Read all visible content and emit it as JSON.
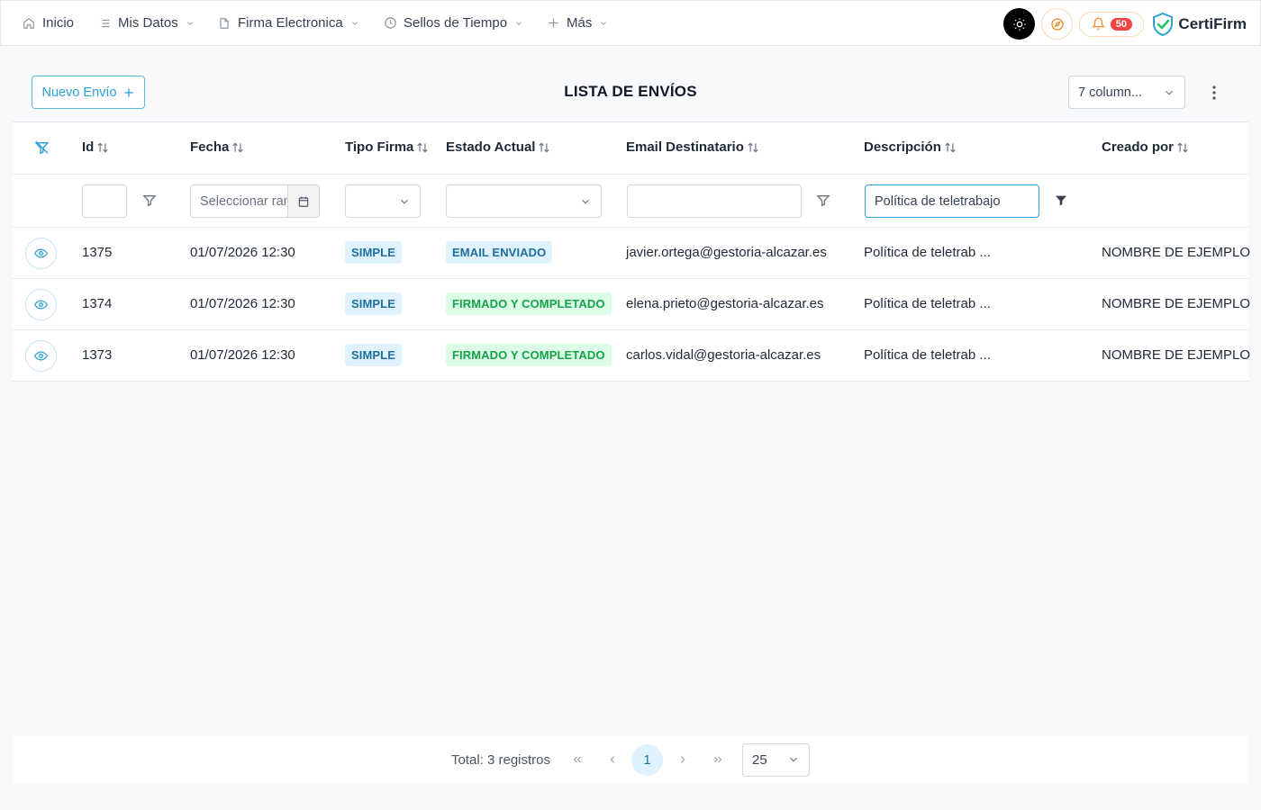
{
  "nav": {
    "items": [
      {
        "label": "Inicio",
        "icon": "home-icon"
      },
      {
        "label": "Mis Datos",
        "icon": "list-icon"
      },
      {
        "label": "Firma Electronica",
        "icon": "document-icon"
      },
      {
        "label": "Sellos de Tiempo",
        "icon": "clock-icon"
      },
      {
        "label": "Más",
        "icon": "plus-icon"
      }
    ],
    "notifications_count": "50",
    "brand": "CertiFirm"
  },
  "page": {
    "title": "LISTA DE ENVÍOS",
    "new_button": "Nuevo Envío",
    "columns_select": "7 column..."
  },
  "table": {
    "headers": [
      "Id",
      "Fecha",
      "Tipo Firma",
      "Estado Actual",
      "Email Destinatario",
      "Descripción",
      "Creado por"
    ],
    "filters": {
      "id": "",
      "fecha_placeholder": "Seleccionar rango",
      "tipo": "",
      "estado": "",
      "email": "",
      "descripcion": "Política de teletrabajo"
    },
    "rows": [
      {
        "id": "1375",
        "fecha": "01/07/2026 12:30",
        "tipo": "SIMPLE",
        "estado": "EMAIL ENVIADO",
        "email": "javier.ortega@gestoria-alcazar.es",
        "descripcion": "Política de teletrab ...",
        "creado": "NOMBRE DE EJEMPLO"
      },
      {
        "id": "1374",
        "fecha": "01/07/2026 12:30",
        "tipo": "SIMPLE",
        "estado": "FIRMADO Y COMPLETADO",
        "email": "elena.prieto@gestoria-alcazar.es",
        "descripcion": "Política de teletrab ...",
        "creado": "NOMBRE DE EJEMPLO"
      },
      {
        "id": "1373",
        "fecha": "01/07/2026 12:30",
        "tipo": "SIMPLE",
        "estado": "FIRMADO Y COMPLETADO",
        "email": "carlos.vidal@gestoria-alcazar.es",
        "descripcion": "Política de teletrab ...",
        "creado": "NOMBRE DE EJEMPLO"
      }
    ]
  },
  "pager": {
    "total": "Total: 3 registros",
    "current_page": "1",
    "page_size": "25"
  },
  "colors": {
    "accent": "#2aa0d8",
    "tag_blue_bg": "#e0f2fe",
    "tag_green_bg": "#dcfce7",
    "notif_red": "#ef4444"
  }
}
